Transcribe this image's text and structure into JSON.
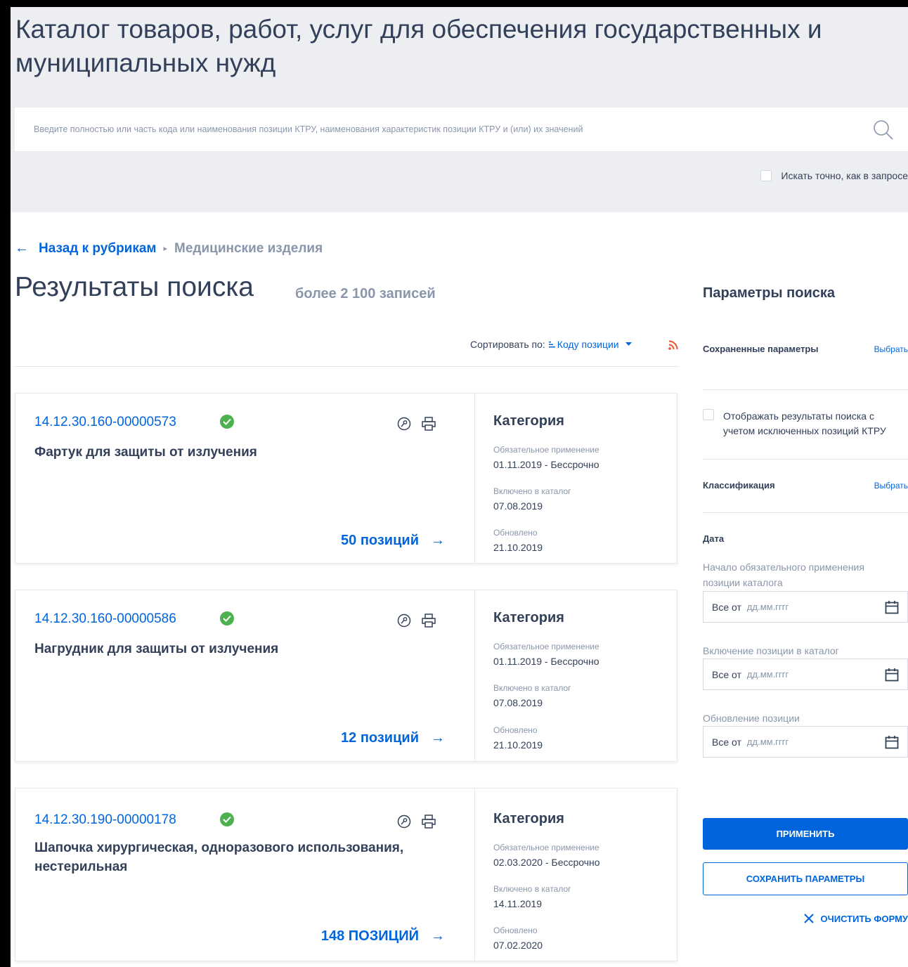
{
  "header": {
    "title": "Каталог товаров, работ, услуг для обеспечения государственных и муниципальных нужд",
    "search_placeholder": "Введите полностью или часть кода или наименования позиции КТРУ, наименования характеристик позиции КТРУ и (или) их значений",
    "exact_label": "Искать точно, как в запросе"
  },
  "breadcrumb": {
    "back_arrow": "←",
    "back_label": "Назад к рубрикам",
    "separator": "▸",
    "current": "Медицинские изделия"
  },
  "results": {
    "title": "Результаты поиска",
    "count": "более 2 100 записей",
    "sort_label": "Сортировать по:",
    "sort_value": "Коду позиции"
  },
  "cards": [
    {
      "code": "14.12.30.160-00000573",
      "name": "Фартук для защиты от излучения",
      "count": "50 позиций",
      "category": "Категория",
      "mandatory_label": "Обязательное применение",
      "mandatory_value": "01.11.2019  - Бессрочно",
      "included_label": "Включено в каталог",
      "included_value": "07.08.2019",
      "updated_label": "Обновлено",
      "updated_value": "21.10.2019"
    },
    {
      "code": "14.12.30.160-00000586",
      "name": "Нагрудник для защиты от излучения",
      "count": "12 позиций",
      "category": "Категория",
      "mandatory_label": "Обязательное применение",
      "mandatory_value": "01.11.2019  - Бессрочно",
      "included_label": "Включено в каталог",
      "included_value": "07.08.2019",
      "updated_label": "Обновлено",
      "updated_value": "21.10.2019"
    },
    {
      "code": "14.12.30.190-00000178",
      "name": "Шапочка хирургическая, одноразового использования, нестерильная",
      "count": "148 ПОЗИЦИЙ",
      "category": "Категория",
      "mandatory_label": "Обязательное применение",
      "mandatory_value": "02.03.2020  - Бессрочно",
      "included_label": "Включено в каталог",
      "included_value": "14.11.2019",
      "updated_label": "Обновлено",
      "updated_value": "07.02.2020"
    }
  ],
  "sidebar": {
    "title": "Параметры поиска",
    "saved_params": "Сохраненные параметры",
    "select_link": "Выбрать",
    "exclude_label": "Отображать результаты поиска с учетом исключенных позиций КТРУ",
    "classification": "Классификация",
    "date_heading": "Дата",
    "date_fields": [
      {
        "label": "Начало обязательного применения позиции каталога",
        "prefix": "Все от",
        "placeholder": "дд.мм.гггг"
      },
      {
        "label": "Включение позиции в каталог",
        "prefix": "Все от",
        "placeholder": "дд.мм.гггг"
      },
      {
        "label": "Обновление позиции",
        "prefix": "Все от",
        "placeholder": "дд.мм.гггг"
      }
    ],
    "apply_button": "ПРИМЕНИТЬ",
    "save_button": "СОХРАНИТЬ ПАРАМЕТРЫ",
    "clear_button": "ОЧИСТИТЬ ФОРМУ"
  },
  "colors": {
    "accent": "#0065dd",
    "text": "#334059",
    "muted": "#8a96ab",
    "header_bg": "#eceef2",
    "success": "#4fb04f",
    "rss": "#e8562a"
  }
}
